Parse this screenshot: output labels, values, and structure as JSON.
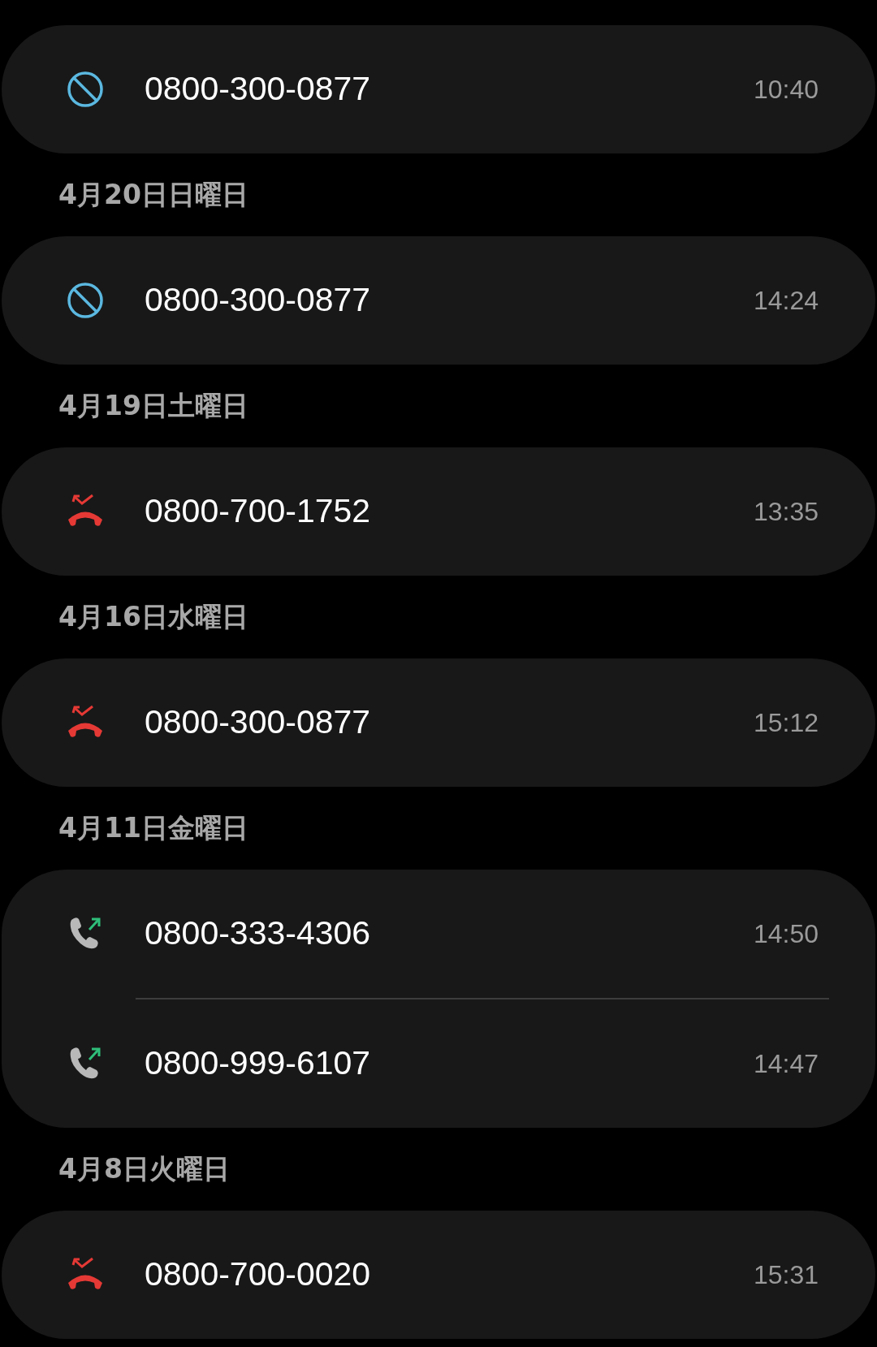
{
  "groups": [
    {
      "calls": [
        {
          "kind": "blocked",
          "number": "0800-300-0877",
          "time": "10:40"
        }
      ]
    },
    {
      "date": "4月20日日曜日",
      "calls": [
        {
          "kind": "blocked",
          "number": "0800-300-0877",
          "time": "14:24"
        }
      ]
    },
    {
      "date": "4月19日土曜日",
      "calls": [
        {
          "kind": "missed",
          "number": "0800-700-1752",
          "time": "13:35"
        }
      ]
    },
    {
      "date": "4月16日水曜日",
      "calls": [
        {
          "kind": "missed",
          "number": "0800-300-0877",
          "time": "15:12"
        }
      ]
    },
    {
      "date": "4月11日金曜日",
      "calls": [
        {
          "kind": "outgoing",
          "number": "0800-333-4306",
          "time": "14:50"
        },
        {
          "kind": "outgoing",
          "number": "0800-999-6107",
          "time": "14:47"
        }
      ]
    },
    {
      "date": "4月8日火曜日",
      "calls": [
        {
          "kind": "missed",
          "number": "0800-700-0020",
          "time": "15:31"
        }
      ]
    }
  ]
}
